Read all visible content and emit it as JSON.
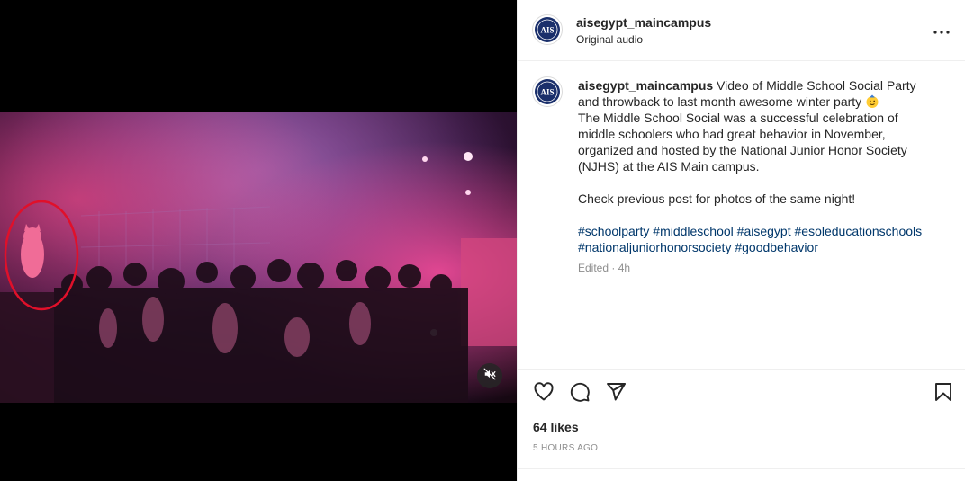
{
  "post": {
    "username": "aisegypt_maincampus",
    "audio": "Original audio",
    "avatar_text": "AIS",
    "caption": {
      "intro": " Video of Middle School Social Party and throwback to last month awesome winter party ",
      "body": "The Middle School Social was a successful celebration of middle schoolers who had great behavior in November, organized and hosted by the National Junior Honor Society (NJHS) at the AIS Main campus.",
      "cta": "Check previous post for photos of the same night!",
      "hashtags": [
        "#schoolparty",
        "#middleschool",
        "#aisegypt",
        "#esoleducationschools",
        "#nationaljuniorhonorsociety",
        "#goodbehavior"
      ]
    },
    "edited": "Edited · 4h",
    "likes": "64 likes",
    "time": "5 HOURS AGO"
  },
  "icons": {
    "more": "more-options-icon",
    "like": "heart-icon",
    "comment": "comment-icon",
    "share": "send-icon",
    "save": "bookmark-icon",
    "mute": "muted-speaker-icon",
    "emoji": "face-with-party-icon"
  },
  "colors": {
    "hashtag": "#00376b",
    "muted_text": "#8e8e8e",
    "annotation": "#e0102a"
  }
}
